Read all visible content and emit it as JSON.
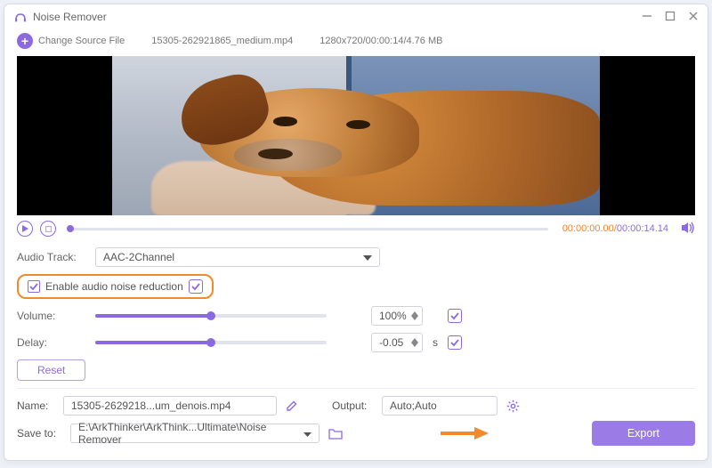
{
  "window": {
    "title": "Noise Remover"
  },
  "source": {
    "change_label": "Change Source File",
    "filename": "15305-262921865_medium.mp4",
    "meta": "1280x720/00:00:14/4.76 MB"
  },
  "timeline": {
    "current": "00:00:00.00",
    "duration": "00:00:14.14",
    "slash": "/"
  },
  "audio": {
    "track_label": "Audio Track:",
    "track_value": "AAC-2Channel",
    "enable_label": "Enable audio noise reduction",
    "volume_label": "Volume:",
    "volume_value": "100%",
    "volume_pct": 50,
    "delay_label": "Delay:",
    "delay_value": "-0.05",
    "delay_unit": "s",
    "delay_pct": 50,
    "reset_label": "Reset"
  },
  "output": {
    "name_label": "Name:",
    "name_value": "15305-2629218...um_denois.mp4",
    "output_label": "Output:",
    "output_value": "Auto;Auto",
    "save_label": "Save to:",
    "save_value": "E:\\ArkThinker\\ArkThink...Ultimate\\Noise Remover",
    "export_label": "Export"
  }
}
